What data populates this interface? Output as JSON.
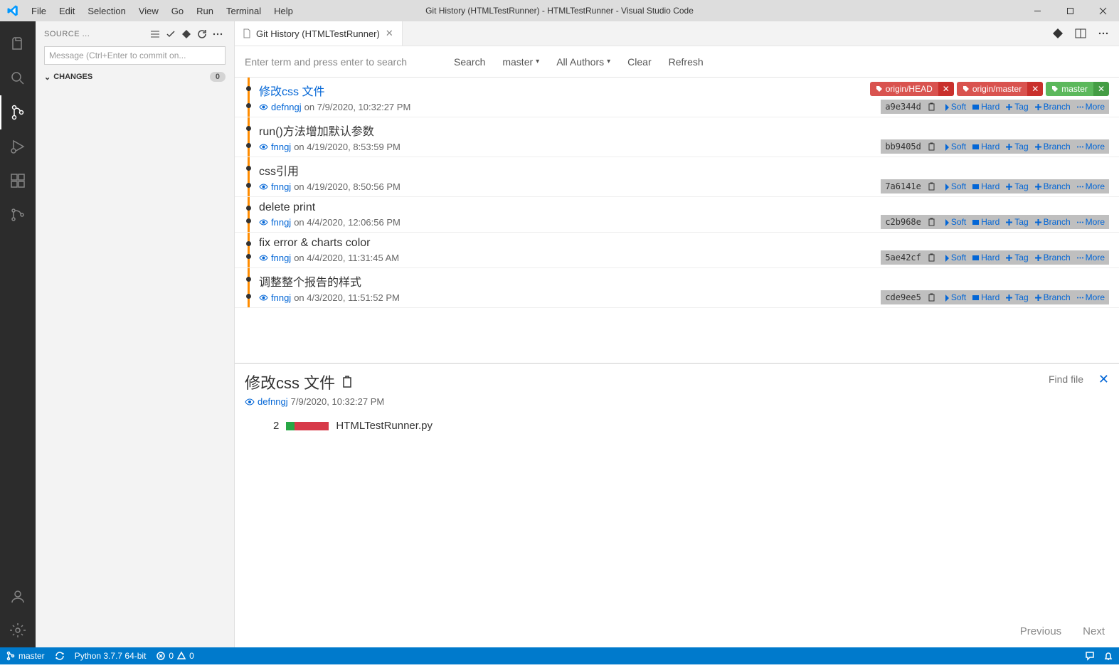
{
  "titlebar": {
    "menu": [
      "File",
      "Edit",
      "Selection",
      "View",
      "Go",
      "Run",
      "Terminal",
      "Help"
    ],
    "title": "Git History (HTMLTestRunner) - HTMLTestRunner - Visual Studio Code"
  },
  "sidebar": {
    "title": "SOURCE ...",
    "commit_placeholder": "Message (Ctrl+Enter to commit on...",
    "changes_label": "CHANGES",
    "changes_count": "0"
  },
  "tab": {
    "label": "Git History (HTMLTestRunner)"
  },
  "toolbar": {
    "search_placeholder": "Enter term and press enter to search",
    "search_btn": "Search",
    "branch": "master",
    "authors": "All Authors",
    "clear": "Clear",
    "refresh": "Refresh"
  },
  "refs": [
    {
      "name": "origin/HEAD",
      "cls": "ref-red"
    },
    {
      "name": "origin/master",
      "cls": "ref-red"
    },
    {
      "name": "master",
      "cls": "ref-green"
    }
  ],
  "action_labels": {
    "soft": "Soft",
    "hard": "Hard",
    "tag": "Tag",
    "branch": "Branch",
    "more": "More"
  },
  "commits": [
    {
      "title": "修改css 文件",
      "author": "defnngj",
      "date": "on 7/9/2020, 10:32:27 PM",
      "hash": "a9e344d",
      "selected": true,
      "show_refs": true
    },
    {
      "title": "run()方法增加默认参数",
      "author": "fnngj",
      "date": "on 4/19/2020, 8:53:59 PM",
      "hash": "bb9405d"
    },
    {
      "title": "css引用",
      "author": "fnngj",
      "date": "on 4/19/2020, 8:50:56 PM",
      "hash": "7a6141e"
    },
    {
      "title": "delete print",
      "author": "fnngj",
      "date": "on 4/4/2020, 12:06:56 PM",
      "hash": "c2b968e"
    },
    {
      "title": "fix error & charts color",
      "author": "fnngj",
      "date": "on 4/4/2020, 11:31:45 AM",
      "hash": "5ae42cf"
    },
    {
      "title": "调整整个报告的样式",
      "author": "fnngj",
      "date": "on 4/3/2020, 11:51:52 PM",
      "hash": "cde9ee5"
    }
  ],
  "detail": {
    "title": "修改css 文件",
    "author": "defnngj",
    "date": "7/9/2020, 10:32:27 PM",
    "find_placeholder": "Find file",
    "file_count": "2",
    "file_name": "HTMLTestRunner.py",
    "prev": "Previous",
    "next": "Next"
  },
  "statusbar": {
    "branch": "master",
    "python": "Python 3.7.7 64-bit",
    "errors": "0",
    "warnings": "0"
  }
}
